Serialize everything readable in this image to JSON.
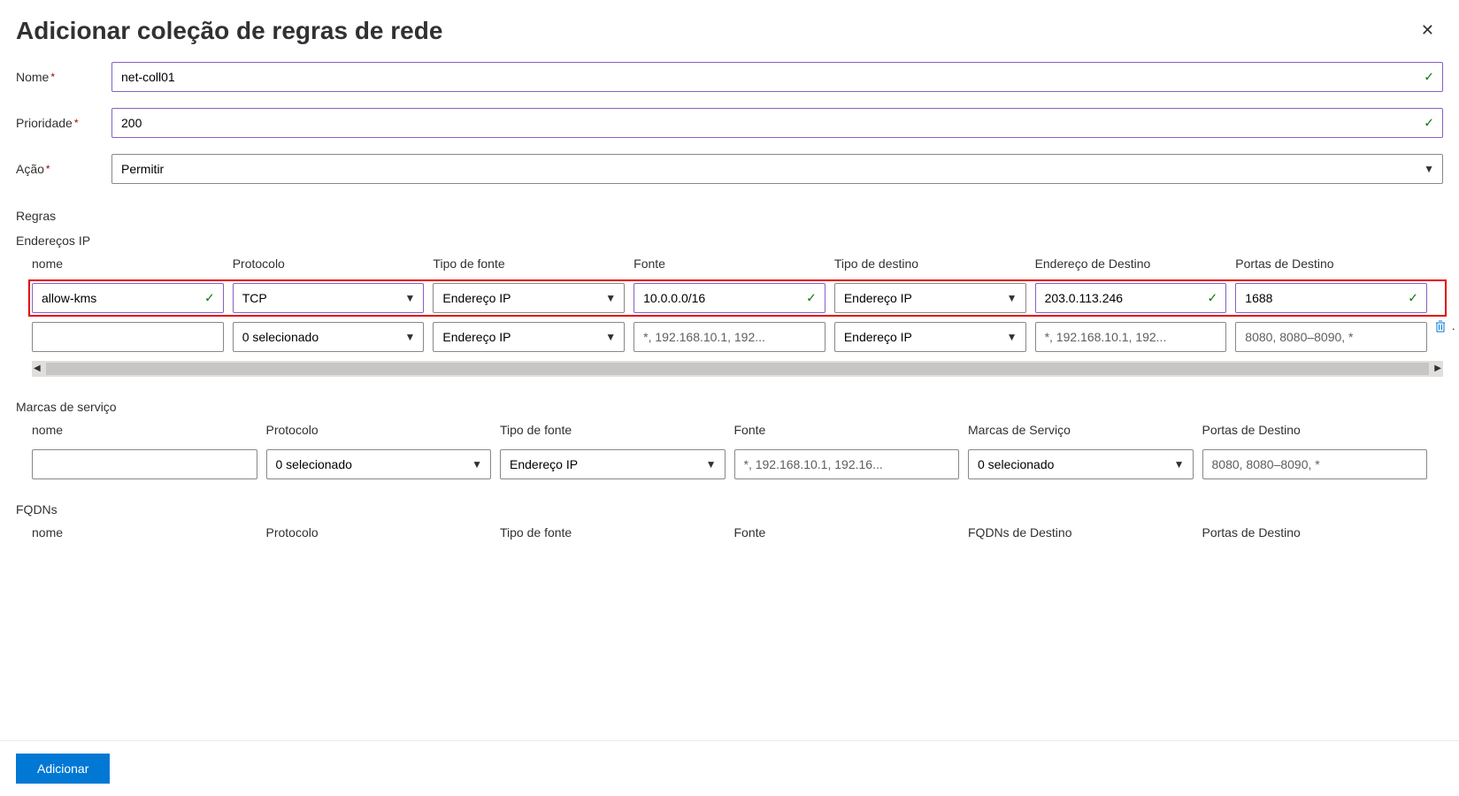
{
  "title": "Adicionar coleção de regras de rede",
  "labels": {
    "name": "Nome",
    "priority": "Prioridade",
    "action": "Ação",
    "rules": "Regras",
    "ip_addresses": "Endereços IP",
    "service_tags": "Marcas de serviço",
    "fqdns": "FQDNs"
  },
  "fields": {
    "name": "net-coll01",
    "priority": "200",
    "action": "Permitir"
  },
  "ip_table": {
    "headers": [
      "nome",
      "Protocolo",
      "Tipo de fonte",
      "Fonte",
      "Tipo de destino",
      "Endereço de Destino",
      "Portas de Destino"
    ],
    "rows": [
      {
        "name": "allow-kms",
        "protocol": "TCP",
        "src_type": "Endereço IP",
        "source": "10.0.0.0/16",
        "dst_type": "Endereço IP",
        "dst_addr": "203.0.113.246",
        "dst_ports": "1688",
        "filled": true
      },
      {
        "name": "",
        "protocol": "0 selecionado",
        "src_type": "Endereço IP",
        "source": "",
        "dst_type": "Endereço IP",
        "dst_addr": "",
        "dst_ports": "",
        "filled": false
      }
    ],
    "placeholders": {
      "source": "*, 192.168.10.1, 192...",
      "dst_addr": "*, 192.168.10.1, 192...",
      "dst_ports": "8080, 8080–8090, *"
    }
  },
  "svc_table": {
    "headers": [
      "nome",
      "Protocolo",
      "Tipo de fonte",
      "Fonte",
      "Marcas de Serviço",
      "Portas de Destino"
    ],
    "row": {
      "protocol": "0 selecionado",
      "src_type": "Endereço IP",
      "src_placeholder": "*, 192.168.10.1, 192.16...",
      "tags": "0 selecionado",
      "ports_placeholder": "8080, 8080–8090, *"
    }
  },
  "fqdn_table": {
    "headers": [
      "nome",
      "Protocolo",
      "Tipo de fonte",
      "Fonte",
      "FQDNs de Destino",
      "Portas de Destino"
    ]
  },
  "buttons": {
    "add": "Adicionar"
  }
}
